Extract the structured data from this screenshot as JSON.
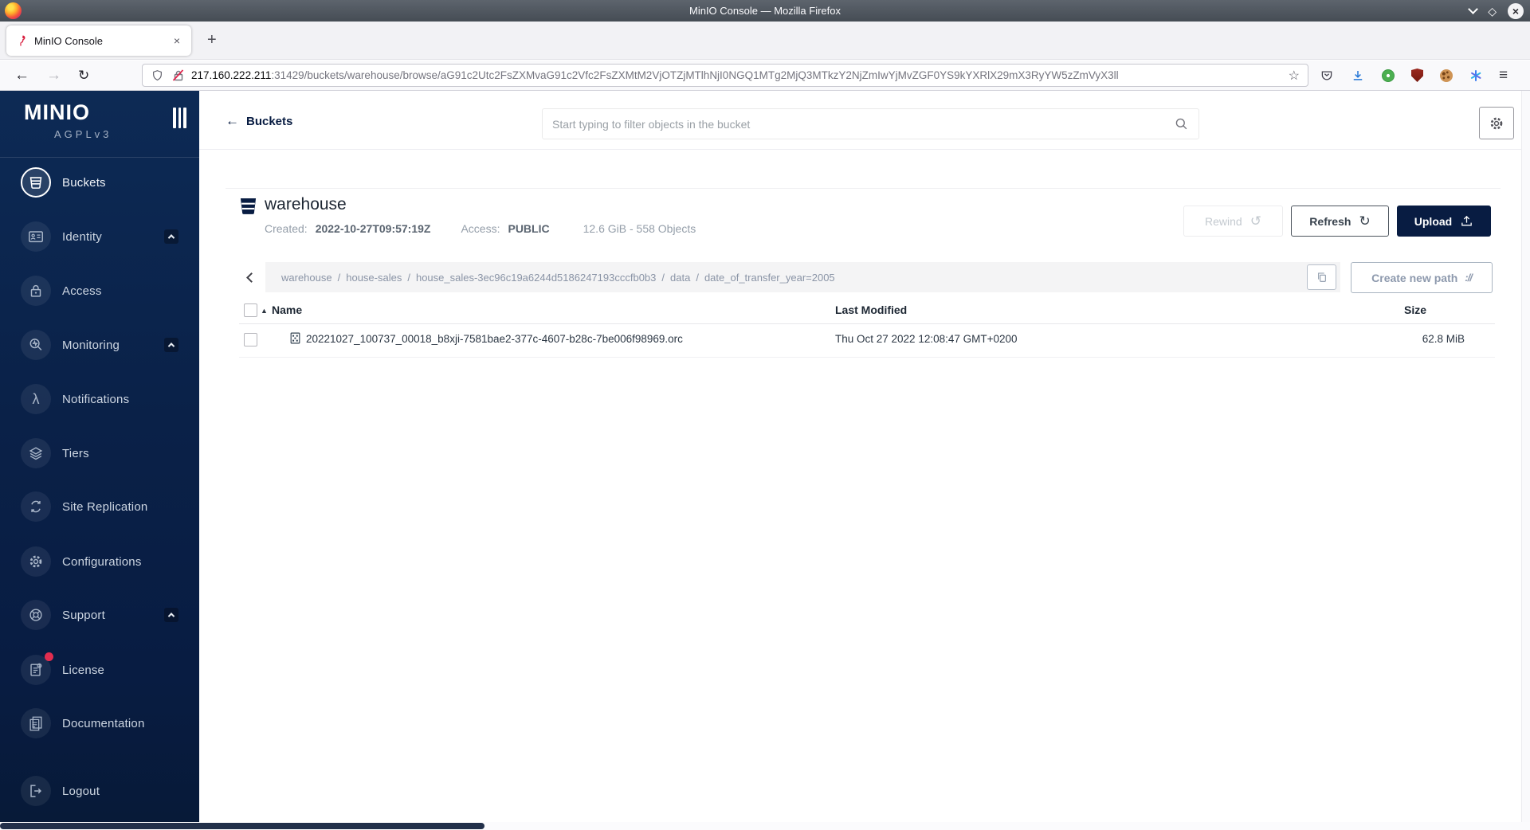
{
  "window": {
    "title": "MinIO Console — Mozilla Firefox"
  },
  "browser": {
    "tab": {
      "title": "MinIO Console"
    },
    "url": {
      "host": "217.160.222.211",
      "path": ":31429/buckets/warehouse/browse/aG91c2Utc2FsZXMvaG91c2Vfc2FsZXMtM2VjOTZjMTlhNjI0NGQ1MTg2MjQ3MTkzY2NjZmIwYjMvZGF0YS9kYXRlX29mX3RyYW5zZmVyX3ll"
    }
  },
  "icons": {
    "close": "×",
    "new_tab": "+",
    "back": "←",
    "forward": "→",
    "reload": "↻",
    "star": "☆",
    "menu": "≡",
    "diamond": "◇",
    "sort_asc": "▲",
    "rewind": "↺",
    "refresh": "↻",
    "lambda": "λ",
    "path": "://"
  },
  "sidebar": {
    "logo": "MINIO",
    "license_tier": "AGPLv3",
    "items": [
      {
        "label": "Buckets"
      },
      {
        "label": "Identity"
      },
      {
        "label": "Access"
      },
      {
        "label": "Monitoring"
      },
      {
        "label": "Notifications"
      },
      {
        "label": "Tiers"
      },
      {
        "label": "Site Replication"
      },
      {
        "label": "Configurations"
      },
      {
        "label": "Support"
      },
      {
        "label": "License"
      },
      {
        "label": "Documentation"
      },
      {
        "label": "Logout"
      }
    ]
  },
  "header": {
    "back_label": "Buckets",
    "search_placeholder": "Start typing to filter objects in the bucket"
  },
  "bucket": {
    "name": "warehouse",
    "created_label": "Created:",
    "created": "2022-10-27T09:57:19Z",
    "access_label": "Access:",
    "access": "PUBLIC",
    "usage": "12.6 GiB - 558 Objects",
    "rewind_label": "Rewind",
    "refresh_label": "Refresh",
    "upload_label": "Upload"
  },
  "browse": {
    "breadcrumb": [
      "warehouse",
      "house-sales",
      "house_sales-3ec96c19a6244d5186247193cccfb0b3",
      "data",
      "date_of_transfer_year=2005"
    ],
    "separator": "/",
    "create_path_label": "Create new path"
  },
  "table": {
    "columns": [
      "Name",
      "Last Modified",
      "Size"
    ],
    "rows": [
      {
        "name": "20221027_100737_00018_b8xji-7581bae2-377c-4607-b28c-7be006f98969.orc",
        "last_modified": "Thu Oct 27 2022 12:08:47 GMT+0200",
        "size": "62.8 MiB"
      }
    ]
  },
  "colors": {
    "sidebar_navy": "#081C42",
    "accent_navy": "#081C42",
    "badge_red": "#e22d4f",
    "breadcrumb_bg": "#f4f4f5"
  }
}
